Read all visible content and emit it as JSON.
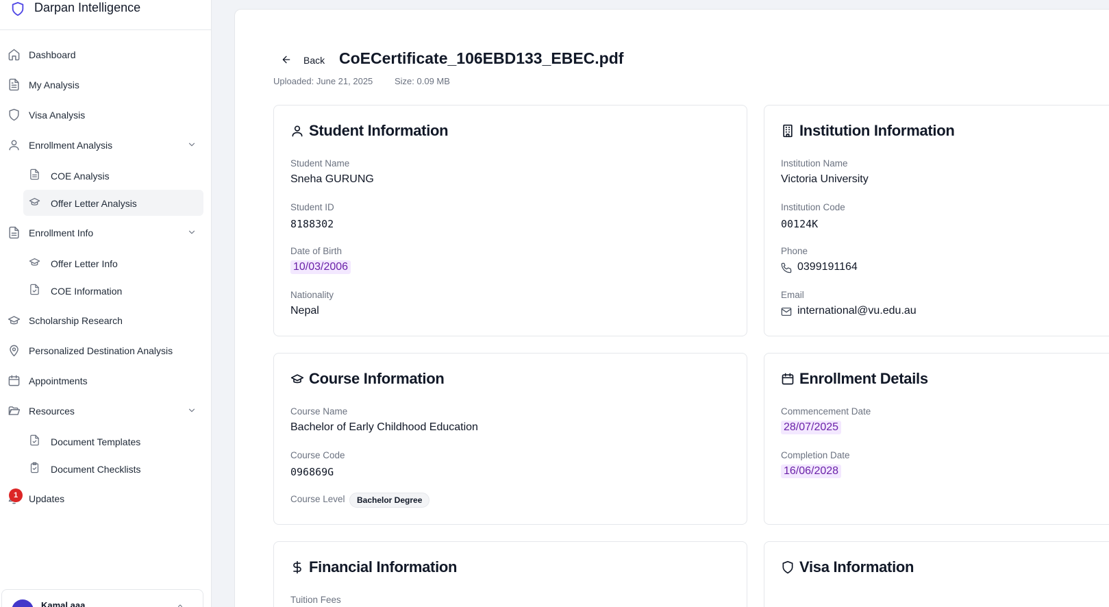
{
  "app": {
    "name": "Darpan Intelligence"
  },
  "sidebar": {
    "items": [
      {
        "label": "Dashboard"
      },
      {
        "label": "My Analysis"
      },
      {
        "label": "Visa Analysis"
      },
      {
        "label": "Enrollment Analysis"
      },
      {
        "label": "COE Analysis"
      },
      {
        "label": "Offer Letter Analysis"
      },
      {
        "label": "Enrollment Info"
      },
      {
        "label": "Offer Letter Info"
      },
      {
        "label": "COE Information"
      },
      {
        "label": "Scholarship Research"
      },
      {
        "label": "Personalized Destination Analysis"
      },
      {
        "label": "Appointments"
      },
      {
        "label": "Resources"
      },
      {
        "label": "Document Templates"
      },
      {
        "label": "Document Checklists"
      },
      {
        "label": "Updates"
      }
    ],
    "updates_badge": "1",
    "user": {
      "name": "Kamal aaa"
    }
  },
  "header": {
    "back_label": "Back",
    "title": "CoECertificate_106EBD133_EBEC.pdf",
    "uploaded": "Uploaded: June 21, 2025",
    "size": "Size: 0.09 MB"
  },
  "student": {
    "title": "Student Information",
    "name_label": "Student Name",
    "name": "Sneha GURUNG",
    "id_label": "Student ID",
    "id": "8188302",
    "dob_label": "Date of Birth",
    "dob": "10/03/2006",
    "nationality_label": "Nationality",
    "nationality": "Nepal"
  },
  "institution": {
    "title": "Institution Information",
    "name_label": "Institution Name",
    "name": "Victoria University",
    "code_label": "Institution Code",
    "code": "00124K",
    "phone_label": "Phone",
    "phone": "0399191164",
    "email_label": "Email",
    "email": "international@vu.edu.au"
  },
  "course": {
    "title": "Course Information",
    "name_label": "Course Name",
    "name": "Bachelor of Early Childhood Education",
    "code_label": "Course Code",
    "code": "096869G",
    "level_label": "Course Level",
    "level": "Bachelor Degree"
  },
  "enrollment": {
    "title": "Enrollment Details",
    "start_label": "Commencement Date",
    "start": "28/07/2025",
    "end_label": "Completion Date",
    "end": "16/06/2028"
  },
  "financial": {
    "title": "Financial Information",
    "tuition_label": "Tuition Fees"
  },
  "visa": {
    "title": "Visa Information"
  },
  "colors": {
    "accent": "#4f46e5",
    "date_chip_bg": "#f3e8ff",
    "date_chip_text": "#6b21a8",
    "badge": "#dc2626"
  }
}
